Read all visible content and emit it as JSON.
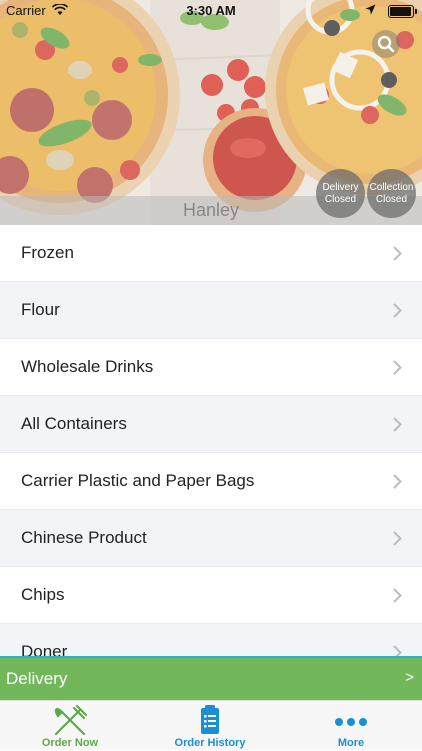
{
  "status_bar": {
    "carrier": "Carrier",
    "time": "3:30 AM"
  },
  "hero": {
    "store_name": "Hanley",
    "delivery_status": {
      "line1": "Delivery",
      "line2": "Closed"
    },
    "collection_status": {
      "line1": "Collection",
      "line2": "Closed"
    }
  },
  "categories": [
    {
      "label": "Frozen"
    },
    {
      "label": "Flour"
    },
    {
      "label": "Wholesale Drinks"
    },
    {
      "label": "All Containers"
    },
    {
      "label": "Carrier Plastic and Paper Bags"
    },
    {
      "label": "Chinese Product"
    },
    {
      "label": "Chips"
    },
    {
      "label": "Doner"
    }
  ],
  "delivery_bar": {
    "label": "Delivery",
    "arrow": ">"
  },
  "tabs": [
    {
      "label": "Order Now",
      "icon": "fork-knife-icon",
      "color": "#5fa84a"
    },
    {
      "label": "Order History",
      "icon": "clipboard-list-icon",
      "color": "#1a8fd6"
    },
    {
      "label": "More",
      "icon": "more-dots-icon",
      "color": "#1a8fd6"
    }
  ],
  "colors": {
    "accent_green": "#72b85b",
    "accent_blue": "#1a8fd6",
    "divider_cyan": "#23b7cf"
  }
}
